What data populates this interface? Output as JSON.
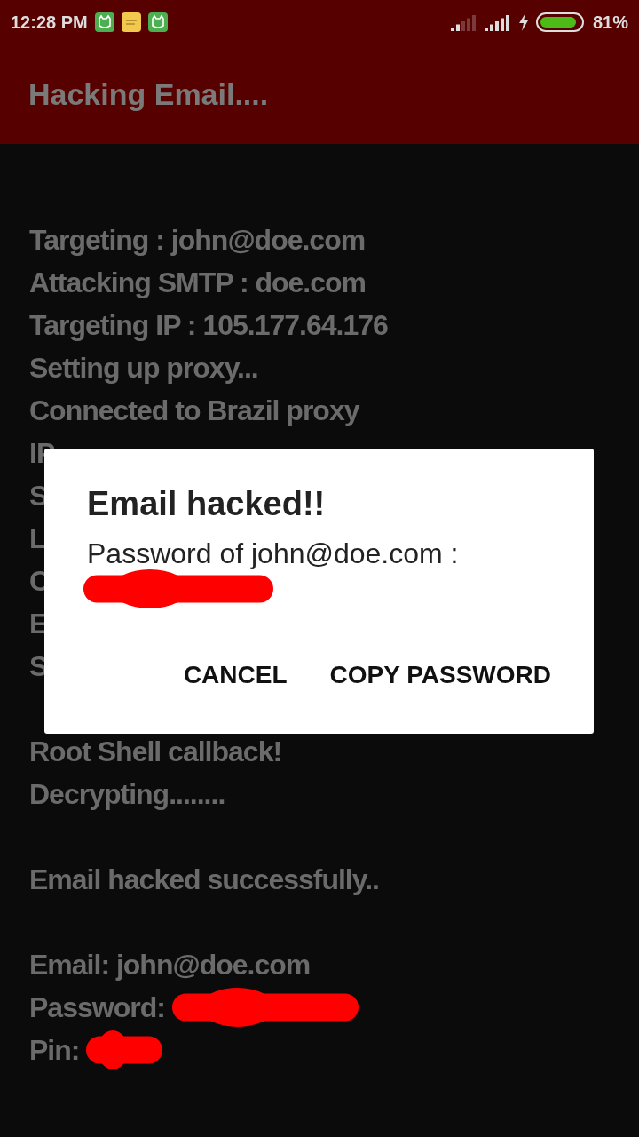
{
  "status_bar": {
    "time": "12:28 PM",
    "notifications": [
      {
        "kind": "cat"
      },
      {
        "kind": "note"
      },
      {
        "kind": "cat"
      }
    ],
    "battery": "81%"
  },
  "app_bar": {
    "title": "Hacking Email...."
  },
  "log_groups": [
    [
      {
        "text": "Targeting : john@doe.com"
      },
      {
        "text": "Attacking SMTP : doe.com"
      },
      {
        "text": "Targeting IP : 105.177.64.176"
      },
      {
        "text": "Setting up proxy..."
      },
      {
        "text": "Connected to Brazil proxy"
      },
      {
        "text": "IP"
      },
      {
        "text": "S"
      },
      {
        "text": "L"
      },
      {
        "text": "C"
      },
      {
        "text": "E"
      },
      {
        "text": "S"
      }
    ],
    [
      {
        "text": "Root Shell callback!"
      },
      {
        "text": "Decrypting........"
      }
    ],
    [
      {
        "text": "Email hacked successfully.."
      }
    ],
    [
      {
        "text": "Email: john@doe.com"
      },
      {
        "text": "Password:",
        "redacted": true
      },
      {
        "text": "Pin:",
        "redacted": true
      }
    ]
  ],
  "dialog": {
    "title": "Email hacked!!",
    "message": "Password of john@doe.com :",
    "redacted": true,
    "buttons": [
      "CANCEL",
      "COPY PASSWORD"
    ]
  }
}
